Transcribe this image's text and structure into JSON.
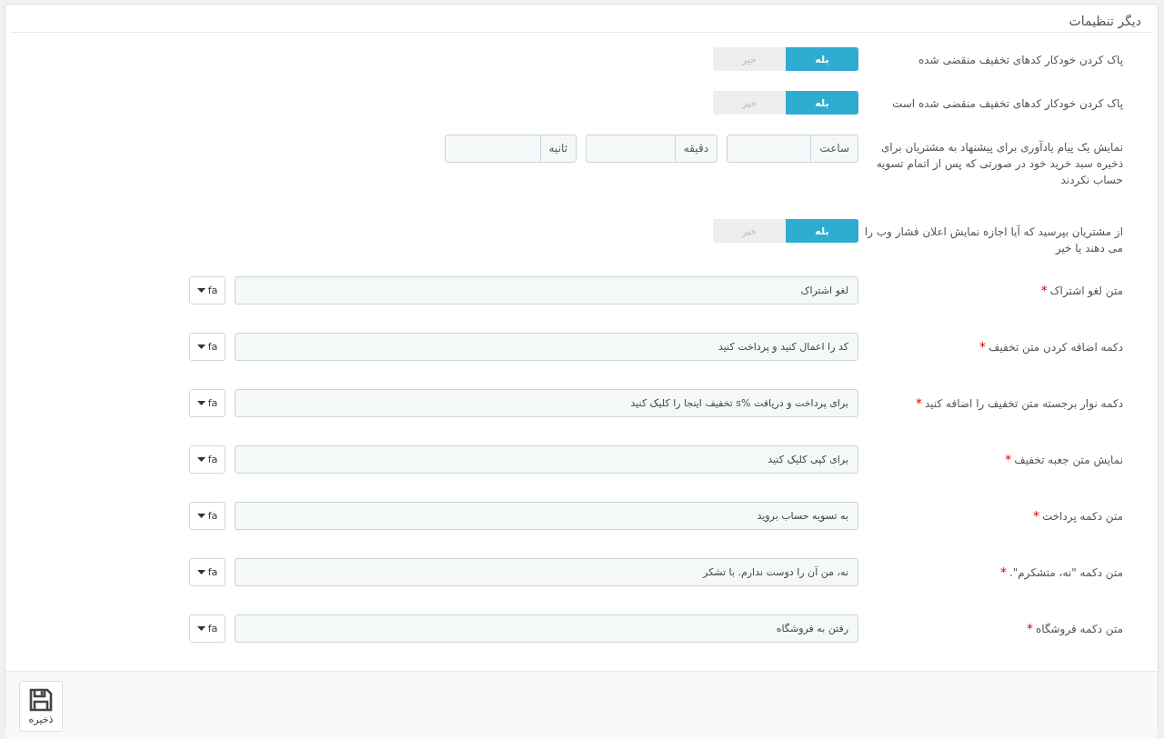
{
  "panel": {
    "title": "دیگر تنظیمات"
  },
  "rows": [
    {
      "kind": "switch",
      "label": "پاک کردن خودکار کدهای تخفیف منقضی شده",
      "options": [
        {
          "label": "بله",
          "selected": true
        },
        {
          "label": "خیر",
          "selected": false
        }
      ]
    },
    {
      "kind": "switch",
      "label": "پاک کردن خودکار کدهای تخفیف منقضی شده است",
      "options": [
        {
          "label": "بله",
          "selected": true
        },
        {
          "label": "خیر",
          "selected": false
        }
      ]
    },
    {
      "kind": "timeouts",
      "label": "نمایش یک پیام یادآوری برای پیشنهاد به مشتریان برای ذخیره سبد خرید خود در صورتی که پس از اتمام تسویه حساب نکردند",
      "units": [
        "ساعت",
        "دقیقه",
        "ثانیه"
      ]
    },
    {
      "kind": "switch",
      "label": "از مشتریان بپرسید که آیا اجازه نمایش اعلان فشار وب را می دهند یا خیر",
      "options": [
        {
          "label": "بله",
          "selected": true
        },
        {
          "label": "خیر",
          "selected": false
        }
      ]
    },
    {
      "kind": "text",
      "label": "متن لغو اشتراک",
      "required_mark": "*",
      "value": "لغو اشتراک",
      "lang": "fa"
    },
    {
      "kind": "text",
      "label": "دکمه اضافه کردن متن تخفیف",
      "required_mark": "*",
      "value": "کد را اعمال کنید و پرداخت کنید",
      "lang": "fa"
    },
    {
      "kind": "text",
      "label": "دکمه نوار برجسته متن تخفیف را اضافه کنید",
      "required_mark": "*",
      "value": "برای پرداخت و دریافت %s تخفیف اینجا را کلیک کنید",
      "lang": "fa"
    },
    {
      "kind": "text",
      "label": "نمایش متن جعبه تخفیف",
      "required_mark": "*",
      "value": "برای کپی کلیک کنید",
      "lang": "fa"
    },
    {
      "kind": "text",
      "label": "متن دکمه پرداخت",
      "required_mark": "*",
      "value": "به تسویه حساب بروید",
      "lang": "fa"
    },
    {
      "kind": "text",
      "label": "متن دکمه \"نه، متشکرم\".",
      "required_mark": "*",
      "value": "نه، من آن را دوست ندارم. با تشکر",
      "lang": "fa"
    },
    {
      "kind": "text",
      "label": "متن دکمه فروشگاه",
      "required_mark": "*",
      "value": "رفتن به فروشگاه",
      "lang": "fa"
    }
  ],
  "footer": {
    "save_label": "ذخیره"
  }
}
